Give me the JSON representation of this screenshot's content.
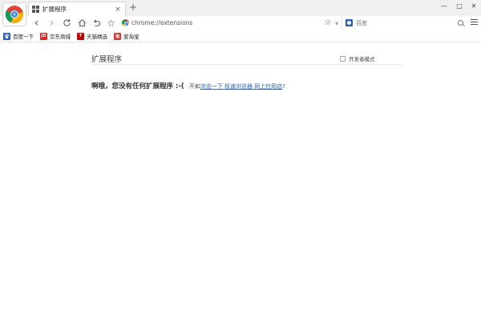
{
  "tab": {
    "title": "扩展程序",
    "close": "×",
    "new_tab": "+"
  },
  "window": {
    "minimize": "—",
    "maximize": "□",
    "close": "✕"
  },
  "nav": {
    "back": "‹",
    "forward": "›",
    "star": "☆"
  },
  "omnibox": {
    "url": "chrome://extensions",
    "star": "☆",
    "dropdown": "∨"
  },
  "search": {
    "placeholder": "百度"
  },
  "bookmarks": [
    {
      "label": "百度一下",
      "icon": "baidu-icon",
      "icon_text": "",
      "color": "#2a5fc2"
    },
    {
      "label": "京东商城",
      "icon": "jd-icon",
      "icon_text": "JD",
      "color": "#e1251b"
    },
    {
      "label": "天猫精选",
      "icon": "tmall-icon",
      "icon_text": "T",
      "color": "#c40000"
    },
    {
      "label": "爱淘宝",
      "icon": "aitaobao-icon",
      "icon_text": "淘",
      "color": "#d43c33"
    }
  ],
  "page": {
    "title": "扩展程序",
    "developer_mode": "开发者模式",
    "empty_message": "啊哦，您没有任何扩展程序 :-(",
    "suggest_prefix": "不如",
    "suggest_link": "浏览一下 极速浏览器 网上应用店",
    "suggest_suffix": "?"
  },
  "colors": {
    "link": "#3366bb",
    "tabstrip": "#f0f0f0"
  }
}
